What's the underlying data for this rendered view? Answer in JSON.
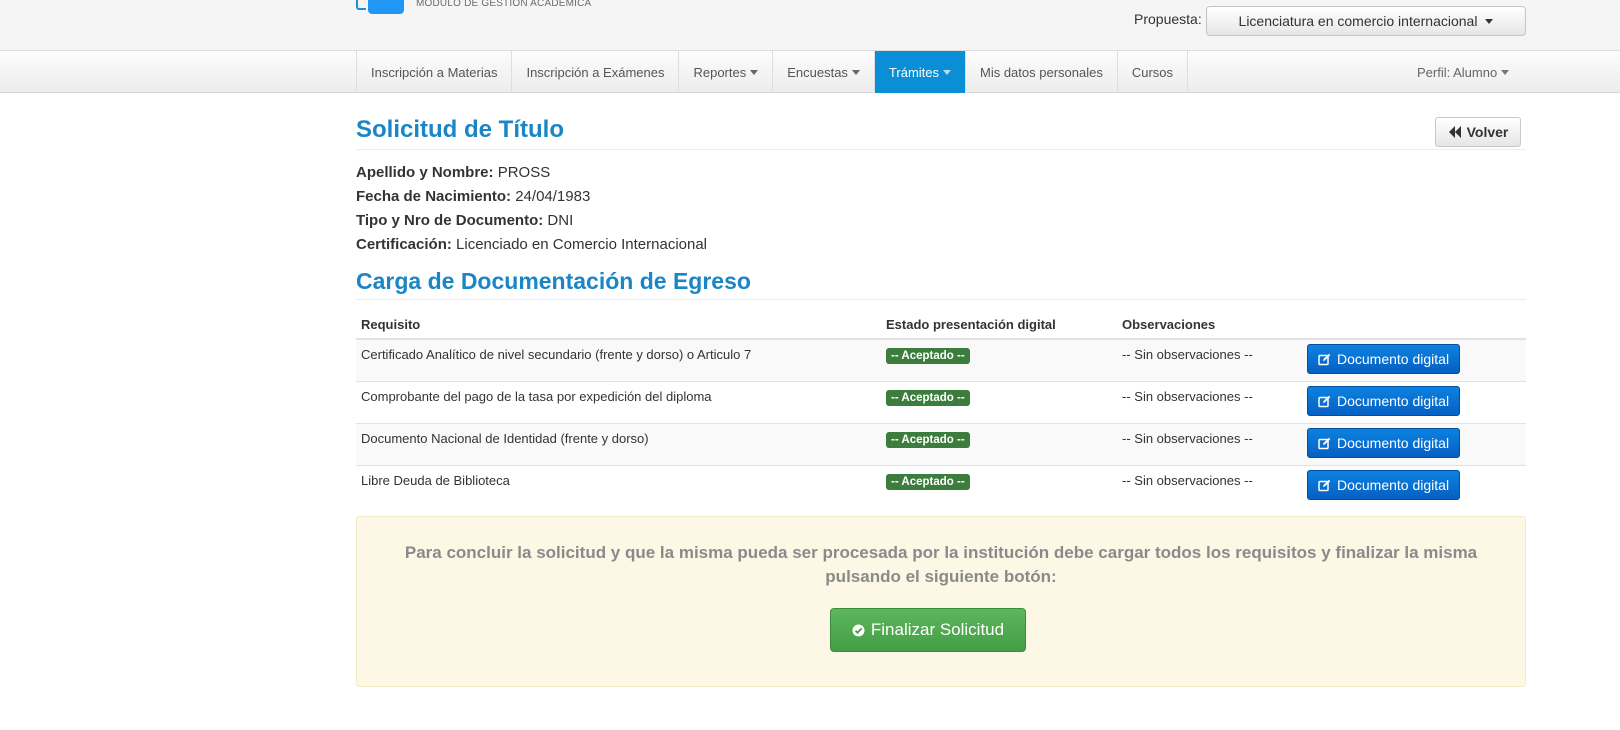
{
  "header": {
    "logo_text": "MÓDULO DE GESTIÓN ACADÉMICA",
    "propuesta_label": "Propuesta:",
    "propuesta_value": "Licenciatura en comercio internacional"
  },
  "nav": {
    "items": [
      {
        "label": "Inscripción a Materias"
      },
      {
        "label": "Inscripción a Exámenes"
      },
      {
        "label": "Reportes"
      },
      {
        "label": "Encuestas"
      },
      {
        "label": "Trámites"
      },
      {
        "label": "Mis datos personales"
      },
      {
        "label": "Cursos"
      }
    ],
    "active": "Trámites",
    "profile": "Perfil: Alumno"
  },
  "page": {
    "title": "Solicitud de Título",
    "back_button": "Volver",
    "fields": [
      {
        "label": "Apellido y Nombre:",
        "value": "PROSS"
      },
      {
        "label": "Fecha de Nacimiento:",
        "value": "24/04/1983"
      },
      {
        "label": "Tipo y Nro de Documento:",
        "value": "DNI"
      },
      {
        "label": "Certificación:",
        "value": "Licenciado en Comercio Internacional"
      }
    ],
    "subtitle": "Carga de Documentación de Egreso"
  },
  "table": {
    "headers": [
      "Requisito",
      "Estado presentación digital",
      "Observaciones",
      ""
    ],
    "rows": [
      {
        "requisito": "Certificado Analítico de nivel secundario (frente y dorso) o Articulo 7",
        "estado": "-- Aceptado --",
        "observaciones": "-- Sin observaciones --",
        "accion": "Documento digital"
      },
      {
        "requisito": "Comprobante del pago de la tasa por expedición del diploma",
        "estado": "-- Aceptado --",
        "observaciones": "-- Sin observaciones --",
        "accion": "Documento digital"
      },
      {
        "requisito": "Documento Nacional de Identidad (frente y dorso)",
        "estado": "-- Aceptado --",
        "observaciones": "-- Sin observaciones --",
        "accion": "Documento digital"
      },
      {
        "requisito": "Libre Deuda de Biblioteca",
        "estado": "-- Aceptado --",
        "observaciones": "-- Sin observaciones --",
        "accion": "Documento digital"
      }
    ]
  },
  "notice": {
    "text": "Para concluir la solicitud y que la misma pueda ser procesada por la institución debe cargar todos los requisitos y finalizar la misma pulsando el siguiente botón:",
    "button": "Finalizar Solicitud"
  },
  "colors": {
    "accent": "#1a86c6",
    "nav_active": "#0a8ed6",
    "badge_success": "#3c7c3c",
    "button_primary": "#0660c4",
    "button_success": "#449d44",
    "notice_bg": "#fcf8e5"
  },
  "icons": {
    "back": "backward-icon",
    "edit": "edit-icon",
    "finalize": "check-circle-icon",
    "dropdown": "caret-down-icon"
  }
}
